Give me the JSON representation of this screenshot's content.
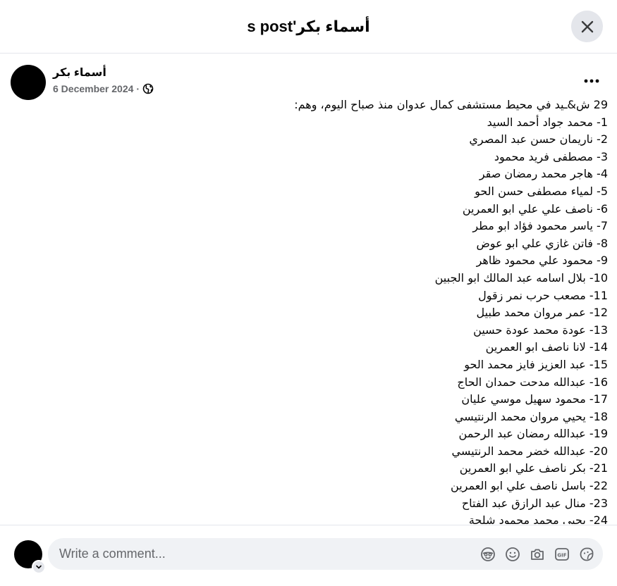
{
  "dialog": {
    "title": "أسماء بكر's post",
    "close_icon": "close-icon"
  },
  "post": {
    "author": "أسماء بكر",
    "date": "6 December 2024",
    "separator": "·",
    "audience_icon": "globe-icon",
    "more_icon": "more-horizontal-icon",
    "lines": [
      "29 ش&ـيد في محيط مستشفى كمال عدوان منذ صباح اليوم، وهم:",
      "1- محمد جواد أحمد السيد",
      "2- ناريمان حسن عبد المصري",
      "3- مصطفى فريد محمود",
      "4- هاجر محمد رمضان صقر",
      "5- لمياء مصطفى حسن الحو",
      "6- ناصف علي علي ابو العمرين",
      "7- ياسر محمود فؤاد ابو مطر",
      "8- فاتن غازي علي ابو عوض",
      "9- محمود علي محمود ظاهر",
      "10- بلال اسامه عبد المالك ابو الجبين",
      "11- مصعب حرب نمر زقول",
      "12- عمر مروان محمد طبيل",
      "13- عودة محمد عودة حسين",
      "14- لانا ناصف ابو العمرين",
      "15- عبد العزيز فايز محمد الحو",
      "16- عبدالله مدحت حمدان الحاج",
      "17- محمود سهيل موسي عليان",
      "18- يحيي مروان محمد الرنتيسي",
      "19- عبدالله رمضان عبد الرحمن",
      "20- عبدالله خضر محمد الرنتيسي",
      "21- بكر ناصف علي ابو العمرين",
      "22- باسل ناصف علي ابو العمرين",
      "23- منال عبد الرازق عبد الفتاح",
      "24- يحيي محمد محمود شلحة"
    ]
  },
  "comment": {
    "placeholder": "Write a comment...",
    "tools": [
      "avatar-sticker-icon",
      "emoji-icon",
      "camera-icon",
      "gif-icon",
      "sticker-icon"
    ]
  },
  "colors": {
    "background": "#ffffff",
    "divider": "#e4e6eb",
    "secondary_text": "#65676b",
    "input_bg": "#f0f2f5"
  }
}
